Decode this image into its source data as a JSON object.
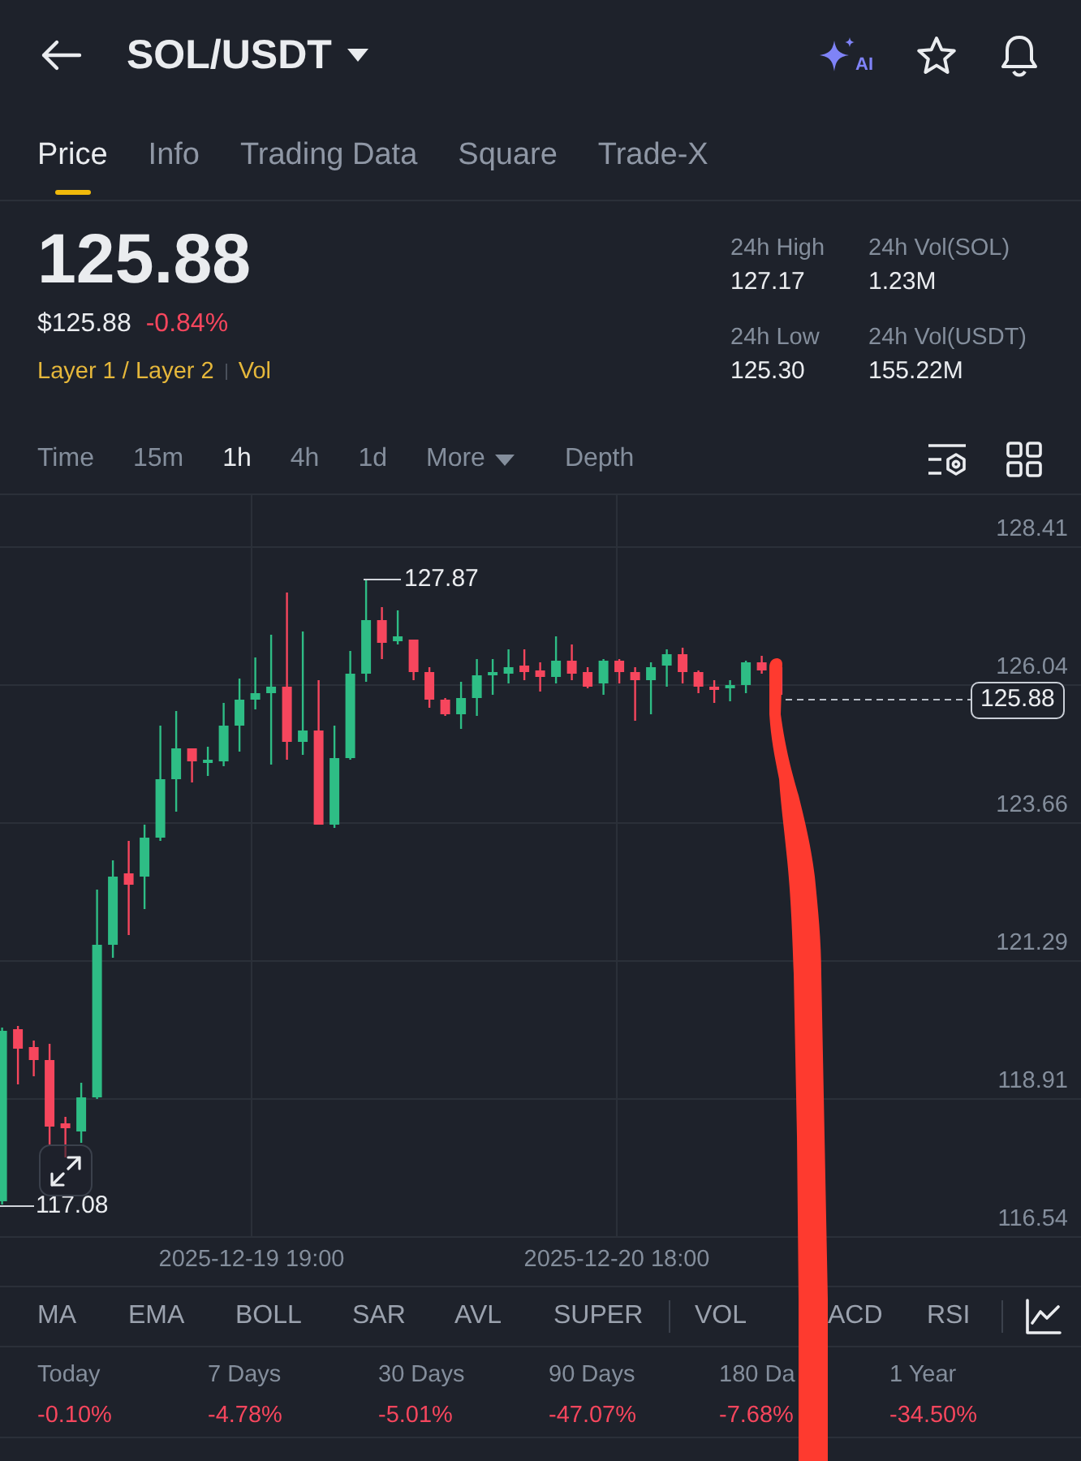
{
  "header": {
    "title": "SOL/USDT",
    "ai_label": "AI"
  },
  "tabs": [
    {
      "label": "Price",
      "selected": true
    },
    {
      "label": "Info",
      "selected": false
    },
    {
      "label": "Trading Data",
      "selected": false
    },
    {
      "label": "Square",
      "selected": false
    },
    {
      "label": "Trade-X",
      "selected": false
    }
  ],
  "ticker": {
    "last_price": "125.88",
    "usd_price": "$125.88",
    "change": "-0.84%",
    "tags": [
      "Layer 1 / Layer 2",
      "Vol"
    ]
  },
  "stats": [
    {
      "label": "24h High",
      "value": "127.17"
    },
    {
      "label": "24h Vol(SOL)",
      "value": "1.23M"
    },
    {
      "label": "24h Low",
      "value": "125.30"
    },
    {
      "label": "24h Vol(USDT)",
      "value": "155.22M"
    }
  ],
  "intervals": [
    {
      "label": "Time",
      "kind": "option",
      "selected": false
    },
    {
      "label": "15m",
      "kind": "option",
      "selected": false
    },
    {
      "label": "1h",
      "kind": "option",
      "selected": true
    },
    {
      "label": "4h",
      "kind": "option",
      "selected": false
    },
    {
      "label": "1d",
      "kind": "option",
      "selected": false
    },
    {
      "label": "More",
      "kind": "dropdown",
      "selected": false
    },
    {
      "label": "Depth",
      "kind": "option",
      "selected": false
    }
  ],
  "chart": {
    "price_labels": [
      "128.41",
      "126.04",
      "123.66",
      "121.29",
      "118.91",
      "116.54"
    ],
    "time_labels": [
      "2025-12-19 19:00",
      "2025-12-20 18:00"
    ],
    "high_label": "127.87",
    "low_label": "117.08",
    "last_price": "125.88"
  },
  "indicators": {
    "main": [
      "MA",
      "EMA",
      "BOLL",
      "SAR",
      "AVL",
      "SUPER"
    ],
    "sub": [
      "VOL",
      "ACD",
      "RSI"
    ]
  },
  "performance": [
    {
      "period": "Today",
      "change": "-0.10%"
    },
    {
      "period": "7 Days",
      "change": "-4.78%"
    },
    {
      "period": "30 Days",
      "change": "-5.01%"
    },
    {
      "period": "90 Days",
      "change": "-47.07%"
    },
    {
      "period": "180 Da",
      "change": "-7.68%"
    },
    {
      "period": "1 Year",
      "change": "-34.50%"
    }
  ]
}
